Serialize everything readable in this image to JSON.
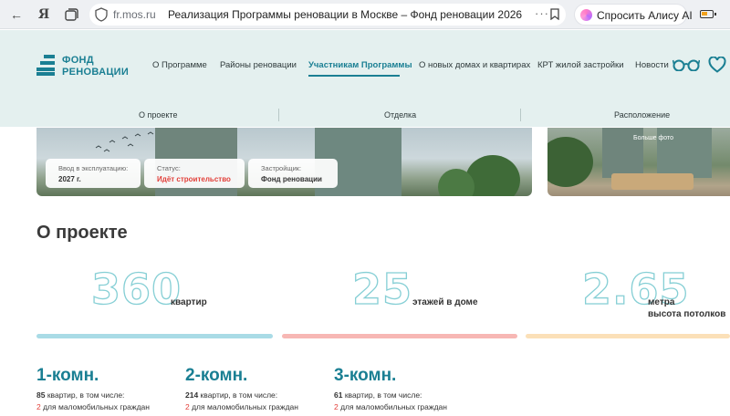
{
  "browser": {
    "yandex_letter": "Я",
    "domain": "fr.mos.ru",
    "page_title": "Реализация Программы реновации в Москве – Фонд реновации 2026",
    "dots": "···",
    "alice_label": "Спросить Алису AI"
  },
  "header": {
    "logo_line1": "ФОНД",
    "logo_line2": "РЕНОВАЦИИ",
    "nav": [
      "О Программе",
      "Районы реновации",
      "Участникам Программы",
      "О новых домах и квартирах",
      "КРТ жилой застройки",
      "Новости"
    ],
    "active_nav_index": 2,
    "subnav": [
      "О проекте",
      "Отделка",
      "Расположение"
    ]
  },
  "hero": {
    "cards": [
      {
        "label": "Ввод в эксплуатацию:",
        "value": "2027 г."
      },
      {
        "label": "Статус:",
        "value": "Идёт строительство"
      },
      {
        "label": "Застройщик:",
        "value": "Фонд реновации"
      }
    ],
    "more_photo": "Больше фото"
  },
  "about": {
    "title": "О проекте",
    "stats": [
      {
        "number": "360",
        "label_line1": "квартир",
        "label_line2": ""
      },
      {
        "number": "25",
        "label_line1": "этажей в доме",
        "label_line2": ""
      },
      {
        "number": "2.65",
        "label_line1": "метра",
        "label_line2": "высота потолков"
      }
    ],
    "bar_colors": [
      "#a9dbe6",
      "#f7b7b4",
      "#fbe0b8"
    ]
  },
  "rooms": [
    {
      "title": "1-комн.",
      "count": "85",
      "count_suffix": " квартир, в том числе:",
      "accessible_count": "2",
      "accessible_suffix": " для маломобильных граждан"
    },
    {
      "title": "2-комн.",
      "count": "214",
      "count_suffix": " квартир, в том числе:",
      "accessible_count": "2",
      "accessible_suffix": " для маломобильных граждан"
    },
    {
      "title": "3-комн.",
      "count": "61",
      "count_suffix": " квартир, в том числе:",
      "accessible_count": "2",
      "accessible_suffix": " для маломобильных граждан"
    }
  ],
  "colors": {
    "brand_teal": "#1a7f93",
    "header_bg": "#e4f0ef",
    "status_red": "#e2403a",
    "outline_number": "#86cfd5"
  }
}
